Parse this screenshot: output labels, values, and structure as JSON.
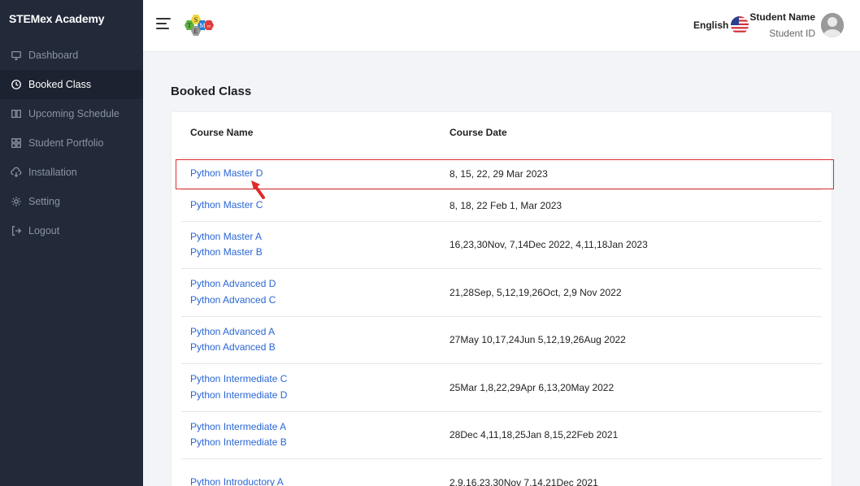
{
  "brand": "STEMex Academy",
  "nav": [
    {
      "label": "Dashboard",
      "icon": "monitor-icon"
    },
    {
      "label": "Booked Class",
      "icon": "clock-icon",
      "active": true
    },
    {
      "label": "Upcoming Schedule",
      "icon": "book-icon"
    },
    {
      "label": "Student Portfolio",
      "icon": "grid-icon"
    },
    {
      "label": "Installation",
      "icon": "cloud-download-icon"
    },
    {
      "label": "Setting",
      "icon": "gear-icon"
    },
    {
      "label": "Logout",
      "icon": "logout-icon"
    }
  ],
  "header": {
    "language": "English",
    "user_name": "Student Name",
    "user_id": "Student ID",
    "logo_letters": [
      "T",
      "S",
      "E",
      "M",
      "ex"
    ]
  },
  "page_title": "Booked Class",
  "table": {
    "headers": [
      "Course Name",
      "Course Date"
    ],
    "rows": [
      {
        "courses": [
          "Python Master D"
        ],
        "date": "8, 15, 22, 29 Mar 2023"
      },
      {
        "courses": [
          "Python Master C"
        ],
        "date": "8, 18, 22 Feb 1, Mar 2023"
      },
      {
        "courses": [
          "Python Master A",
          "Python Master B"
        ],
        "date": "16,23,30Nov, 7,14Dec 2022, 4,11,18Jan 2023"
      },
      {
        "courses": [
          "Python Advanced D",
          "Python Advanced C"
        ],
        "date": "21,28Sep, 5,12,19,26Oct, 2,9 Nov 2022"
      },
      {
        "courses": [
          "Python Advanced A",
          "Python Advanced B"
        ],
        "date": "27May 10,17,24Jun 5,12,19,26Aug 2022"
      },
      {
        "courses": [
          "Python Intermediate C",
          "Python Intermediate D"
        ],
        "date": "25Mar 1,8,22,29Apr 6,13,20May 2022"
      },
      {
        "courses": [
          "Python Intermediate A",
          "Python Intermediate B"
        ],
        "date": "28Dec 4,11,18,25Jan 8,15,22Feb 2021"
      },
      {
        "courses": [
          "Python Introductory A"
        ],
        "date": "2,9,16,23,30Nov 7,14,21Dec 2021"
      }
    ]
  },
  "colors": {
    "sidebar_bg": "#222a3a",
    "link": "#2966d6",
    "highlight": "#e02a2a"
  }
}
